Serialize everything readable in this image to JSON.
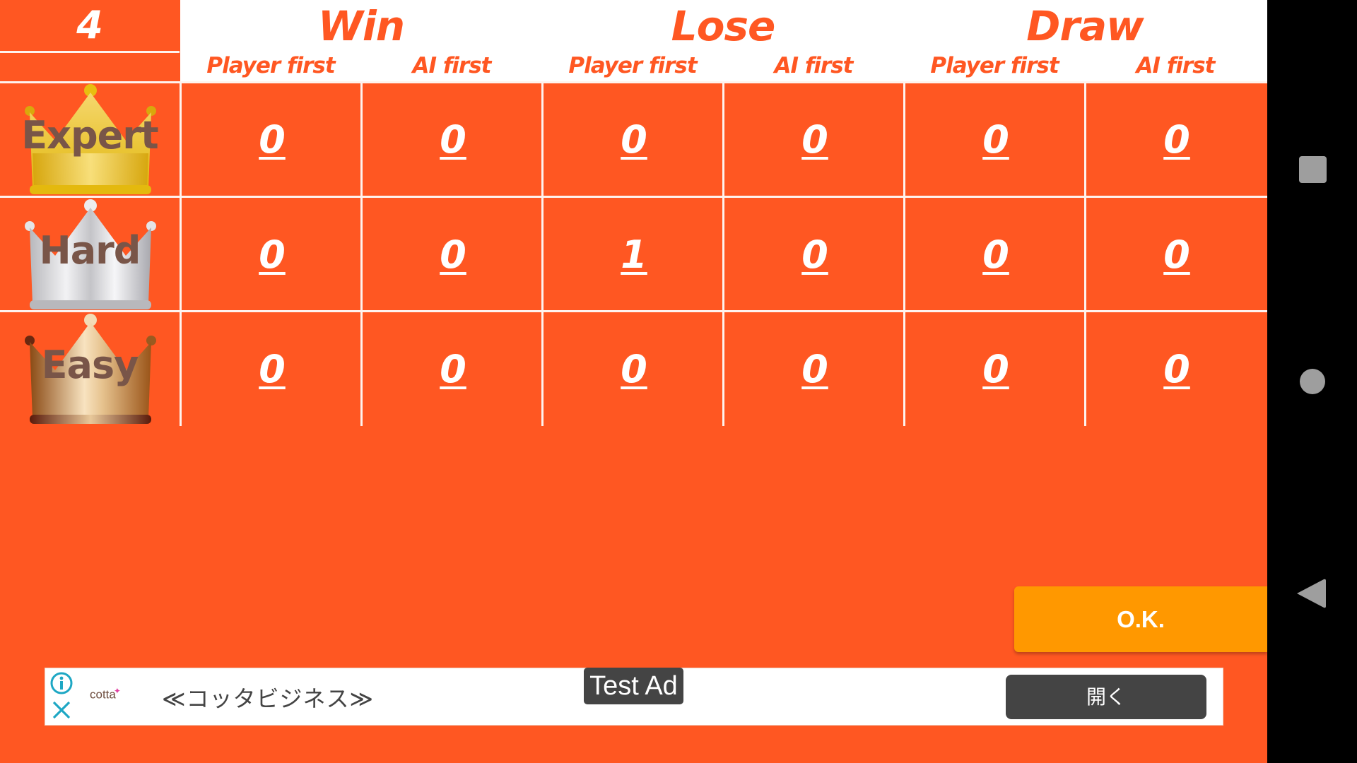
{
  "header": {
    "game_count": "4",
    "groups": [
      {
        "label": "Win"
      },
      {
        "label": "Lose"
      },
      {
        "label": "Draw"
      }
    ],
    "columns": [
      "Player first",
      "AI first",
      "Player first",
      "AI first",
      "Player first",
      "AI first"
    ]
  },
  "rows": [
    {
      "label": "Expert",
      "crown": "gold-crown-icon",
      "values": [
        "0",
        "0",
        "0",
        "0",
        "0",
        "0"
      ]
    },
    {
      "label": "Hard",
      "crown": "silver-crown-icon",
      "values": [
        "0",
        "0",
        "1",
        "0",
        "0",
        "0"
      ]
    },
    {
      "label": "Easy",
      "crown": "bronze-crown-icon",
      "values": [
        "0",
        "0",
        "0",
        "0",
        "0",
        "0"
      ]
    }
  ],
  "ok_button": {
    "label": "O.K."
  },
  "ad": {
    "info_icon": "info-icon",
    "close_icon": "close-icon",
    "brand": "cotta",
    "headline": "≪コッタビジネス≫",
    "test_label": "Test Ad",
    "open_label": "開く"
  },
  "nav": {
    "recents": "square-icon",
    "home": "circle-icon",
    "back": "triangle-back-icon"
  },
  "colors": {
    "primary": "#FF5722",
    "button": "#FF9800",
    "label_text": "#795548",
    "ad_button": "#444444"
  }
}
